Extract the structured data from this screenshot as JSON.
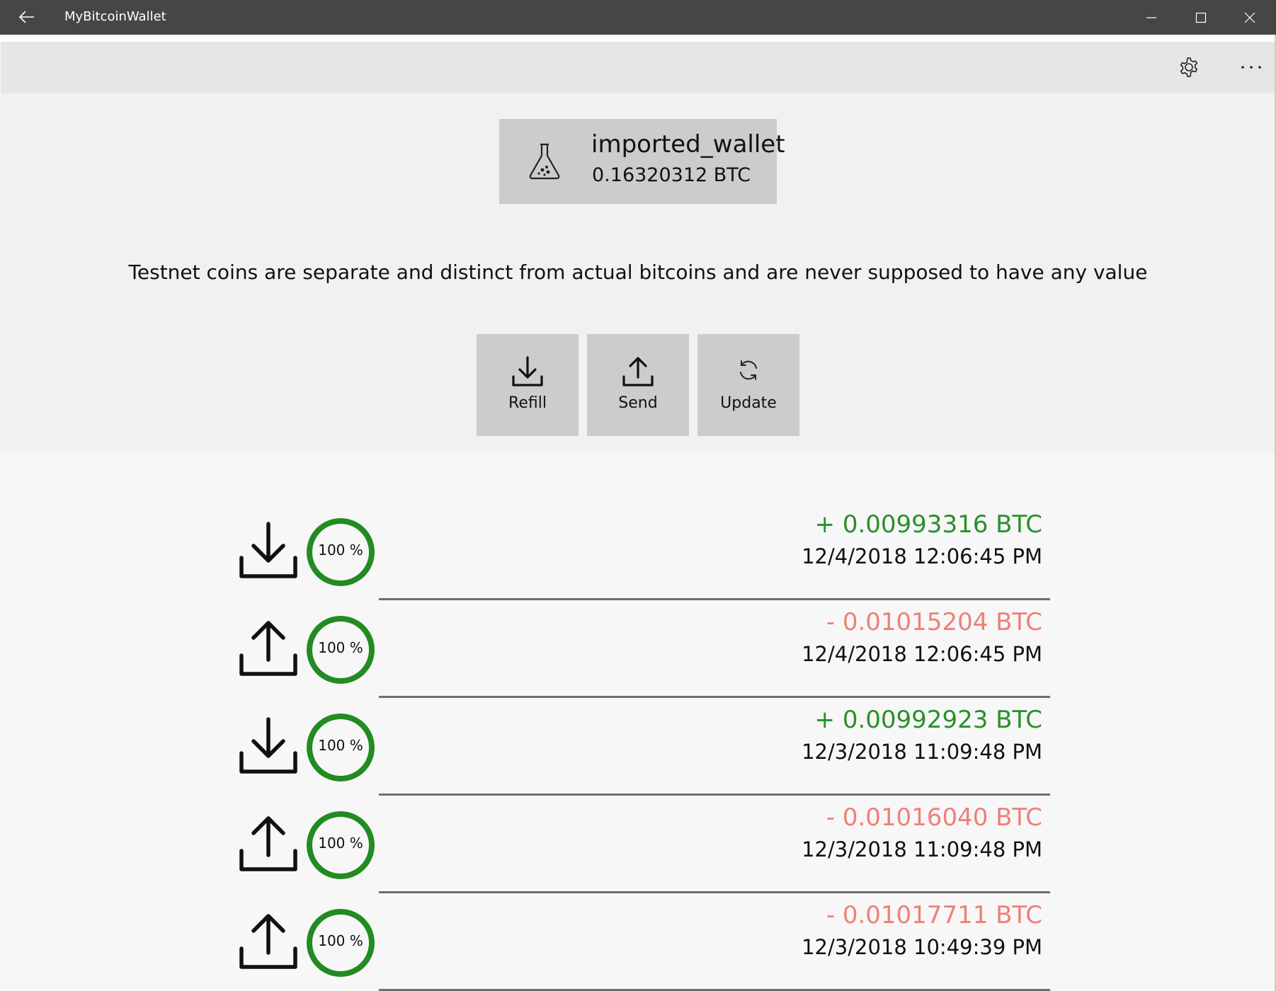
{
  "window": {
    "title": "MyBitcoinWallet",
    "icons": {
      "back": "back-arrow-icon",
      "minimize": "minimize-icon",
      "maximize": "maximize-icon",
      "close": "close-icon"
    }
  },
  "commandbar": {
    "settings_icon": "gear-icon",
    "more_icon": "more-ellipsis-icon"
  },
  "wallet": {
    "name": "imported_wallet",
    "balance": "0.16320312 BTC",
    "icon": "flask-icon"
  },
  "notice": "Testnet coins are separate and distinct from actual bitcoins and are never supposed to have any value",
  "actions": [
    {
      "label": "Refill",
      "icon": "download-icon"
    },
    {
      "label": "Send",
      "icon": "upload-icon"
    },
    {
      "label": "Update",
      "icon": "refresh-icon"
    }
  ],
  "colors": {
    "incoming": "#2a8f2a",
    "outgoing": "#ee8077",
    "progress_ring": "#228b22",
    "titlebar": "#464646"
  },
  "transactions": [
    {
      "direction": "in",
      "amount": "+ 0.00993316 BTC",
      "date": "12/4/2018 12:06:45 PM",
      "progress": "100 %",
      "progress_value": 100
    },
    {
      "direction": "out",
      "amount": "- 0.01015204 BTC",
      "date": "12/4/2018 12:06:45 PM",
      "progress": "100 %",
      "progress_value": 100
    },
    {
      "direction": "in",
      "amount": "+ 0.00992923 BTC",
      "date": "12/3/2018 11:09:48 PM",
      "progress": "100 %",
      "progress_value": 100
    },
    {
      "direction": "out",
      "amount": "- 0.01016040 BTC",
      "date": "12/3/2018 11:09:48 PM",
      "progress": "100 %",
      "progress_value": 100
    },
    {
      "direction": "out",
      "amount": "- 0.01017711 BTC",
      "date": "12/3/2018 10:49:39 PM",
      "progress": "100 %",
      "progress_value": 100
    }
  ]
}
